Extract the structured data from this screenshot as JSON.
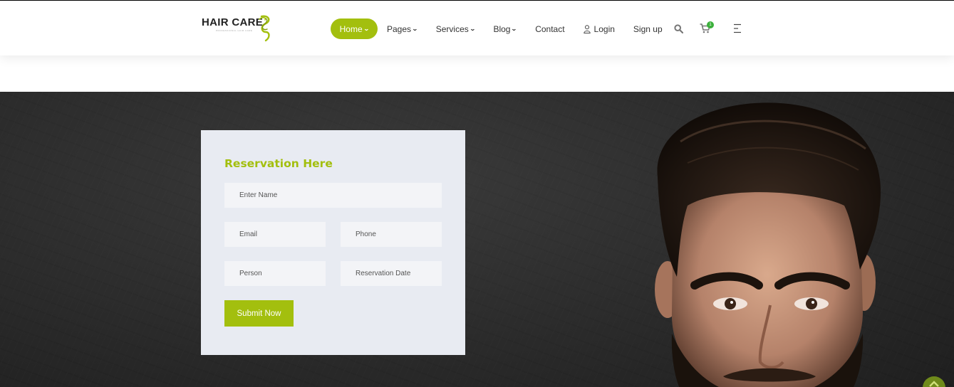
{
  "logo": {
    "text": "HAIR CARE",
    "tagline": "PROFESSIONAL HAIR CARE"
  },
  "nav": {
    "items": [
      {
        "label": "Home",
        "dropdown": true,
        "active": true
      },
      {
        "label": "Pages",
        "dropdown": true
      },
      {
        "label": "Services",
        "dropdown": true
      },
      {
        "label": "Blog",
        "dropdown": true
      },
      {
        "label": "Contact",
        "dropdown": false
      },
      {
        "label": "Login",
        "dropdown": false,
        "icon": "user-icon"
      },
      {
        "label": "Sign up",
        "dropdown": false
      }
    ],
    "cart_count": "1",
    "icons": [
      "search-icon",
      "cart-icon",
      "menu-icon"
    ]
  },
  "reservation": {
    "title": "Reservation Here",
    "fields": {
      "name": "Enter Name",
      "email": "Email",
      "phone": "Phone",
      "person": "Person",
      "date": "Reservation Date"
    },
    "submit_label": "Submit Now"
  },
  "colors": {
    "accent": "#a3bf0e",
    "card_bg": "#e8ebf2",
    "hero_bg": "#2b2b2b"
  }
}
